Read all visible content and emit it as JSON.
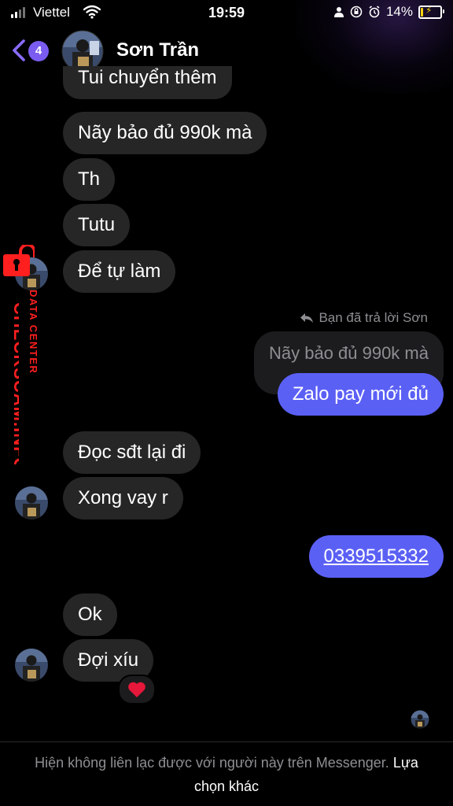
{
  "status_bar": {
    "carrier": "Viettel",
    "time": "19:59",
    "battery": "14%"
  },
  "header": {
    "back_count": "4",
    "contact_name": "Sơn Trần"
  },
  "messages": [
    {
      "from": "contact",
      "text": "Tui chuyển thêm"
    },
    {
      "from": "contact",
      "text": "Nãy bảo đủ 990k mà"
    },
    {
      "from": "contact",
      "text": "Th"
    },
    {
      "from": "contact",
      "text": "Tutu"
    },
    {
      "from": "contact",
      "text": "Để tự làm"
    },
    {
      "from": "me",
      "reply_note": "Bạn đã trả lời Sơn",
      "quoted": "Nãy bảo đủ 990k mà",
      "text": "Zalo pay mới đủ"
    },
    {
      "from": "contact",
      "text": "Đọc sđt lại đi"
    },
    {
      "from": "contact",
      "text": "Xong vay r"
    },
    {
      "from": "me",
      "text": "0339515332"
    },
    {
      "from": "contact",
      "text": "Ok"
    },
    {
      "from": "contact",
      "text": "Đợi xíu",
      "reaction": "❤️"
    }
  ],
  "watermark": {
    "brand": "CHECKSCAM.INFO",
    "sub": "DATA CENTER",
    "color": "#ff1f1f"
  },
  "footer": {
    "notice": "Hiện không liên lạc được với người này trên Messenger.",
    "link": "Lựa chọn khác"
  },
  "colors": {
    "incoming_bubble": "#262626",
    "outgoing_bubble": "#5b60f5",
    "accent": "#7a5cf0"
  }
}
